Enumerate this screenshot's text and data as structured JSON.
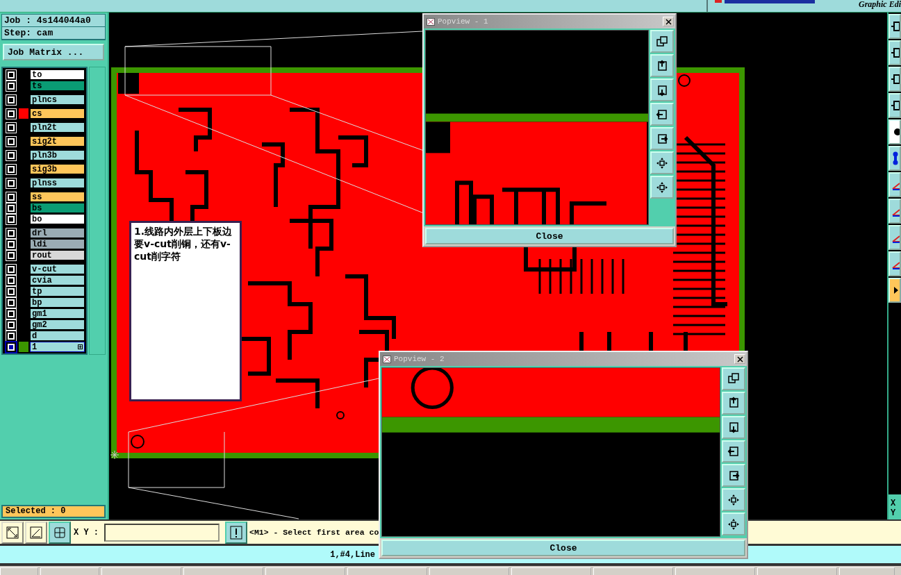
{
  "top_bar": {
    "subtitle": "Graphic Edi"
  },
  "job_panel": {
    "job": "Job : 4s144044a0",
    "step": "Step: cam",
    "matrix_button": "Job Matrix ..."
  },
  "layer_groups": [
    {
      "layers": [
        {
          "name": "to",
          "color": "#ffffff",
          "checked": false,
          "selected": false
        },
        {
          "name": "ts",
          "color": "#0a9c74",
          "checked": false,
          "selected": false
        }
      ]
    },
    {
      "layers": [
        {
          "name": "plncs",
          "color": "#9edbdb",
          "checked": false,
          "selected": false
        }
      ]
    },
    {
      "layers": [
        {
          "name": "cs",
          "color": "#ffc65a",
          "swatch": {
            "color": "#ff0000"
          },
          "checked": false,
          "selected": false
        }
      ]
    },
    {
      "layers": [
        {
          "name": "pln2t",
          "color": "#9edbdb",
          "checked": false,
          "selected": false
        }
      ]
    },
    {
      "layers": [
        {
          "name": "sig2t",
          "color": "#ffc65a",
          "checked": false,
          "selected": false
        }
      ]
    },
    {
      "layers": [
        {
          "name": "pln3b",
          "color": "#9edbdb",
          "checked": false,
          "selected": false
        }
      ]
    },
    {
      "layers": [
        {
          "name": "sig3b",
          "color": "#ffc65a",
          "checked": false,
          "selected": false
        }
      ]
    },
    {
      "layers": [
        {
          "name": "plnss",
          "color": "#9edbdb",
          "checked": false,
          "selected": false
        }
      ]
    },
    {
      "layers": [
        {
          "name": "ss",
          "color": "#ffc65a",
          "checked": false,
          "selected": false
        },
        {
          "name": "bs",
          "color": "#0a9c74",
          "checked": false,
          "selected": false
        },
        {
          "name": "bo",
          "color": "#ffffff",
          "checked": false,
          "selected": false
        }
      ]
    },
    {
      "layers": [
        {
          "name": "drl",
          "color": "#9aacb4",
          "checked": false,
          "selected": false
        },
        {
          "name": "ldi",
          "color": "#9aacb4",
          "checked": false,
          "selected": false
        },
        {
          "name": "rout",
          "color": "#d8d8d8",
          "checked": false,
          "selected": false
        }
      ]
    },
    {
      "layers": [
        {
          "name": "v-cut",
          "color": "#9edbdb",
          "checked": false,
          "selected": false
        },
        {
          "name": "cvia",
          "color": "#9edbdb",
          "checked": false,
          "selected": false
        },
        {
          "name": "tp",
          "color": "#9edbdb",
          "checked": false,
          "selected": false
        },
        {
          "name": "bp",
          "color": "#9edbdb",
          "checked": false,
          "selected": false
        },
        {
          "name": "gm1",
          "color": "#9edbdb",
          "checked": false,
          "selected": false
        },
        {
          "name": "gm2",
          "color": "#9edbdb",
          "checked": false,
          "selected": false
        },
        {
          "name": "d",
          "color": "#9edbdb",
          "checked": false,
          "selected": false
        },
        {
          "name": "1",
          "color": "#9edbdb",
          "swatch": {
            "color": "#3c9600"
          },
          "checked": false,
          "selected": true
        }
      ]
    }
  ],
  "selected_count": "Selected : 0",
  "canvas": {
    "note": "1.线路内外层上下板边要v-cut削铜，还有v-cut削字符"
  },
  "popviews": [
    {
      "title": "Popview - 1",
      "close": "Close"
    },
    {
      "title": "Popview - 2",
      "close": "Close"
    }
  ],
  "command_bar": {
    "xy_label": "X Y :",
    "prompt": "<M1> - Select first area co"
  },
  "status_bar": {
    "text": "1,#4,Line"
  },
  "right_panel": {
    "axis_labels": [
      "X",
      "Y"
    ]
  }
}
